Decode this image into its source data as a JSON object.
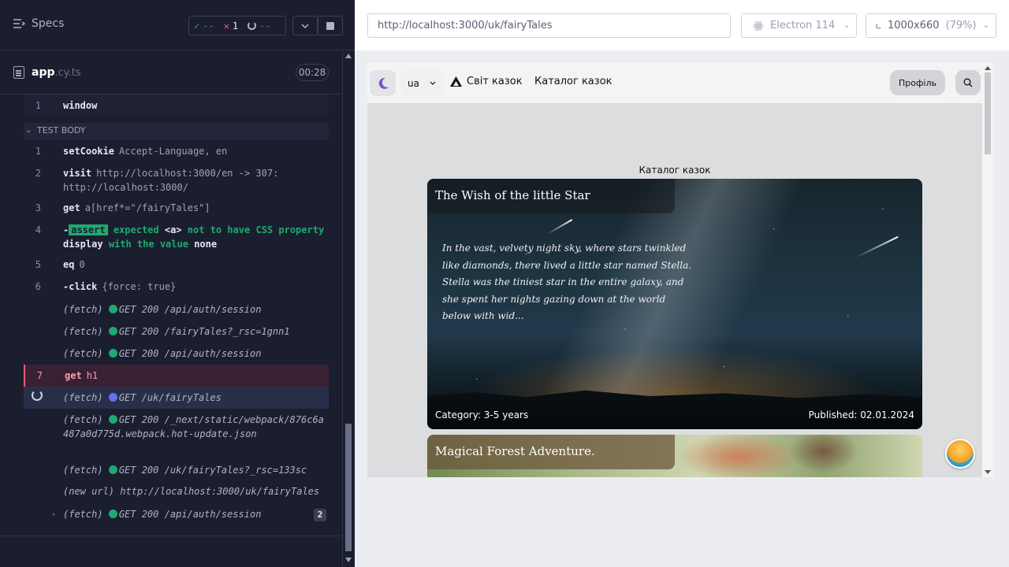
{
  "runner": {
    "specs_label": "Specs",
    "stats": {
      "passed": "--",
      "failed": "1",
      "pending": "--"
    },
    "file": {
      "name": "app",
      "ext": ".cy.ts",
      "duration": "00:28"
    },
    "window_label": "window",
    "test_body_label": "TEST BODY",
    "commands": [
      {
        "num": "1",
        "name": "setCookie",
        "args": "Accept-Language, en"
      },
      {
        "num": "2",
        "name": "visit",
        "args": "http://localhost:3000/en -> 307: http://localhost:3000/"
      },
      {
        "num": "3",
        "name": "get",
        "args": "a[href*=\"/fairyTales\"]"
      },
      {
        "num": "4",
        "prefix": "-",
        "tag": "assert",
        "parts": [
          "expected",
          "<a>",
          "not to have CSS property",
          "display",
          "with the value",
          "none"
        ]
      },
      {
        "num": "5",
        "name": "eq",
        "args": "0"
      },
      {
        "num": "6",
        "name": "-click",
        "args": "{force: true}"
      },
      {
        "name": "(fetch)",
        "args": "GET 200 /api/auth/session"
      },
      {
        "name": "(fetch)",
        "args": "GET 200 /fairyTales?_rsc=1gnn1"
      },
      {
        "name": "(fetch)",
        "args": "GET 200 /api/auth/session"
      },
      {
        "num": "7",
        "name": "get",
        "args": "h1"
      },
      {
        "name": "(fetch)",
        "args": "GET /uk/fairyTales"
      },
      {
        "name": "(fetch)",
        "args": "GET 200 /_next/static/webpack/876c6a487a0d775d.webpack.hot-update.json"
      },
      {
        "name": "(fetch)",
        "args": "GET 200 /uk/fairyTales?_rsc=133sc"
      },
      {
        "name": "(new url)",
        "args": "http://localhost:3000/uk/fairyTales"
      },
      {
        "name": "(fetch)",
        "args": "GET 200 /api/auth/session",
        "count": "2"
      }
    ]
  },
  "browser": {
    "url": "http://localhost:3000/uk/fairyTales",
    "engine": "Electron 114",
    "viewport": "1000x660",
    "zoom": "(79%)"
  },
  "app": {
    "lang": "ua",
    "brand": "Світ казок",
    "nav_catalog": "Каталог казок",
    "profile": "Профіль",
    "page_heading": "Каталог казок",
    "cards": [
      {
        "title": "The Wish of the little Star",
        "excerpt": "In the vast, velvety night sky, where stars twinkled like diamonds, there lived a little star named Stella. Stella was the tiniest star in the entire galaxy, and she spent her nights gazing down at the world below with wid...",
        "category": "Category: 3-5 years",
        "published": "Published: 02.01.2024"
      },
      {
        "title": "Magical Forest Adventure."
      }
    ]
  },
  "colors": {
    "runner_bg": "#1b1e2e",
    "pass": "#1fa971",
    "fail": "#f15b6c",
    "accent_blue": "#6470f3"
  }
}
